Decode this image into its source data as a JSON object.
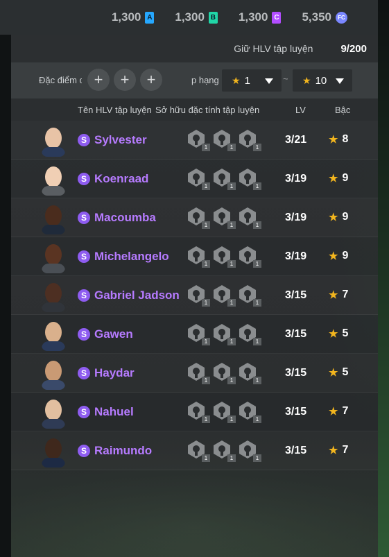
{
  "currency": [
    {
      "value": "1,300",
      "icon": "currency-a-icon",
      "label": "A",
      "color": "#26a8ff"
    },
    {
      "value": "1,300",
      "icon": "currency-b-icon",
      "label": "B",
      "color": "#21d6a7"
    },
    {
      "value": "1,300",
      "icon": "currency-c-icon",
      "label": "C",
      "color": "#b24dff"
    },
    {
      "value": "5,350",
      "icon": "fc-points-icon",
      "label": "FC",
      "color": "#7a87ff"
    }
  ],
  "keep": {
    "label": "Giữ HLV tập luyện",
    "value": "9/200"
  },
  "filters": {
    "trait_label": "Đặc điểm c",
    "plus": "+",
    "rank_label": "p hạng",
    "min_rank": "1",
    "max_rank": "10",
    "separator": "~"
  },
  "columns": {
    "name": "Tên HLV tập luyện",
    "traits": "Sở hữu đặc tính tập luyện",
    "lv": "LV",
    "grade": "Bậc"
  },
  "badge_letter": "S",
  "coaches": [
    {
      "name": "Sylvester",
      "lv": "3/21",
      "grade": "8",
      "traits": [
        "1",
        "1",
        "1"
      ],
      "trait_icons": [
        "rook-icon",
        "wall-icon",
        "dribble-icon"
      ]
    },
    {
      "name": "Koenraad",
      "lv": "3/19",
      "grade": "9",
      "traits": [
        "1",
        "1",
        "1"
      ],
      "trait_icons": [
        "kick-icon",
        "arrow-up-icon",
        "tactics-icon"
      ]
    },
    {
      "name": "Macoumba",
      "lv": "3/19",
      "grade": "9",
      "traits": [
        "1",
        "1",
        "1"
      ],
      "trait_icons": [
        "kick-icon",
        "lock-icon",
        "run-icon"
      ]
    },
    {
      "name": "Michelangelo",
      "lv": "3/19",
      "grade": "9",
      "traits": [
        "1",
        "1",
        "1"
      ],
      "trait_icons": [
        "kick-icon",
        "curve-icon",
        "dribble-icon"
      ]
    },
    {
      "name": "Gabriel Jadson",
      "lv": "3/15",
      "grade": "7",
      "traits": [
        "1",
        "1",
        "1"
      ],
      "trait_icons": [
        "pin-icon",
        "curve-icon",
        "ball-icon"
      ]
    },
    {
      "name": "Gawen",
      "lv": "3/15",
      "grade": "5",
      "traits": [
        "1",
        "1",
        "1"
      ],
      "trait_icons": [
        "target-icon",
        "kick-icon",
        "wave-icon"
      ]
    },
    {
      "name": "Haydar",
      "lv": "3/15",
      "grade": "5",
      "traits": [
        "1",
        "1",
        "1"
      ],
      "trait_icons": [
        "kick-icon",
        "curve-icon",
        "run-icon"
      ]
    },
    {
      "name": "Nahuel",
      "lv": "3/15",
      "grade": "7",
      "traits": [
        "1",
        "1",
        "1"
      ],
      "trait_icons": [
        "pin-icon",
        "curve-icon",
        "ball-icon"
      ]
    },
    {
      "name": "Raimundo",
      "lv": "3/15",
      "grade": "7",
      "traits": [
        "1",
        "1",
        "1"
      ],
      "trait_icons": [
        "target-icon",
        "lock-icon",
        "pin-icon"
      ]
    }
  ],
  "colors": {
    "accent": "#b67bff",
    "badge": "#8e5cf0",
    "star": "#f2b51e"
  }
}
